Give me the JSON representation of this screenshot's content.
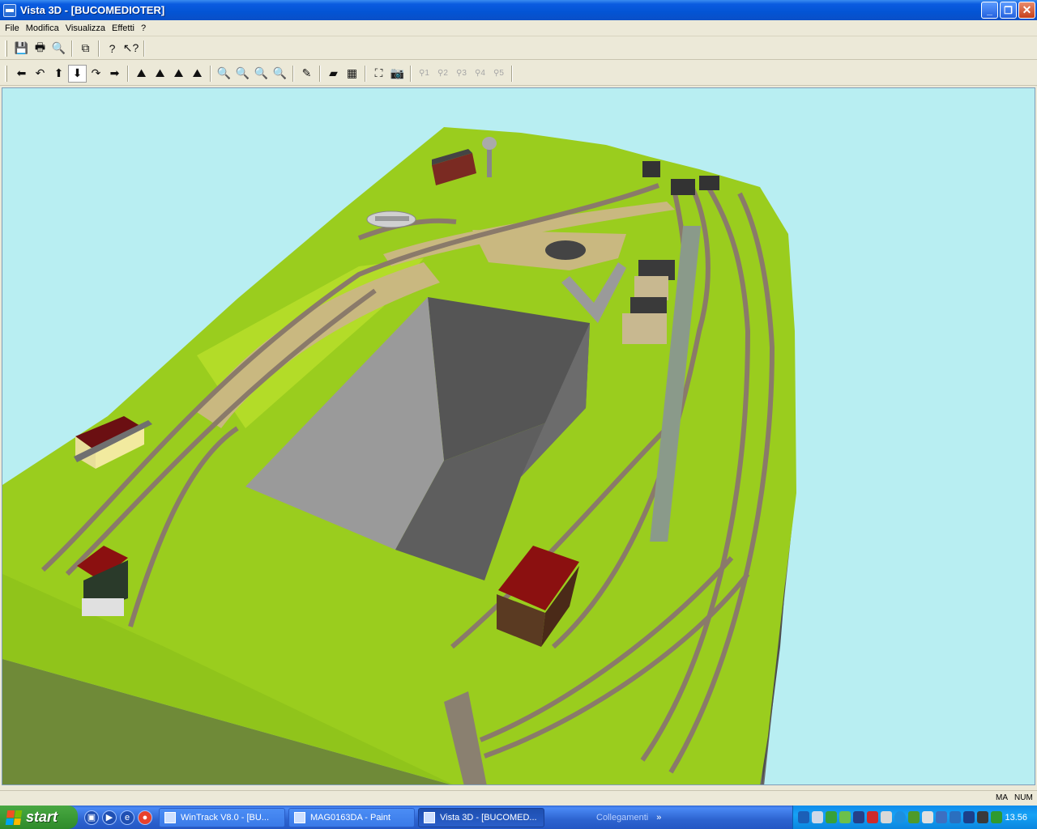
{
  "window": {
    "title": "Vista 3D - [BUCOMEDIOTER]",
    "icon": "train-app-icon",
    "buttons": {
      "minimize": "_",
      "restore": "❐",
      "close": "✕"
    }
  },
  "menu": [
    "File",
    "Modifica",
    "Visualizza",
    "Effetti",
    "?"
  ],
  "toolbar1": [
    {
      "name": "save-icon",
      "glyph": "💾"
    },
    {
      "name": "print-icon",
      "glyph": "🖶"
    },
    {
      "name": "print-preview-icon",
      "glyph": "🔍"
    },
    {
      "name": "copy-icon",
      "glyph": "⧉"
    },
    {
      "name": "help-icon",
      "glyph": "?"
    },
    {
      "name": "context-help-icon",
      "glyph": "↖?"
    }
  ],
  "toolbar2": {
    "navigation": [
      {
        "name": "arrow-left-icon",
        "glyph": "⬅"
      },
      {
        "name": "turn-left-icon",
        "glyph": "↶"
      },
      {
        "name": "arrow-up-icon",
        "glyph": "⬆"
      },
      {
        "name": "arrow-down-icon",
        "glyph": "⬇",
        "pressed": true
      },
      {
        "name": "turn-right-icon",
        "glyph": "↷"
      },
      {
        "name": "arrow-right-icon",
        "glyph": "➡"
      }
    ],
    "view": [
      {
        "name": "view-tilt-icon",
        "glyph": "⛰"
      },
      {
        "name": "view-up-icon",
        "glyph": "⛰"
      },
      {
        "name": "view-down-icon",
        "glyph": "⛰"
      },
      {
        "name": "view-rotate-icon",
        "glyph": "⛰"
      }
    ],
    "zoom": [
      {
        "name": "zoom-out-icon",
        "glyph": "🔍"
      },
      {
        "name": "zoom-out-small-icon",
        "glyph": "🔍"
      },
      {
        "name": "zoom-in-icon",
        "glyph": "🔍"
      },
      {
        "name": "zoom-in-fast-icon",
        "glyph": "🔍"
      }
    ],
    "tools": [
      {
        "name": "track-tool-icon",
        "glyph": "✎"
      },
      {
        "name": "terrain-icon",
        "glyph": "▰"
      },
      {
        "name": "grid-icon",
        "glyph": "▦"
      },
      {
        "name": "fit-view-icon",
        "glyph": "⛶"
      },
      {
        "name": "camera-icon",
        "glyph": "📷"
      }
    ],
    "cameras": [
      "1",
      "2",
      "3",
      "4",
      "5"
    ]
  },
  "status": {
    "ma": "MA",
    "num": "NUM"
  },
  "taskbar": {
    "start": "start",
    "tasks": [
      {
        "label": "WinTrack  V8.0 - [BU...",
        "active": false
      },
      {
        "label": "MAG0163DA - Paint",
        "active": false
      },
      {
        "label": "Vista 3D - [BUCOMED...",
        "active": true
      }
    ],
    "links": "Collegamenti",
    "clock": "13.56"
  },
  "colors": {
    "sky": "#B8EEF2",
    "terrain": "#9ACD1E",
    "terrain_dark": "#7FB514",
    "track": "#8a7a6a",
    "pit": "#5f5f5f",
    "roof": "#8B1010"
  }
}
